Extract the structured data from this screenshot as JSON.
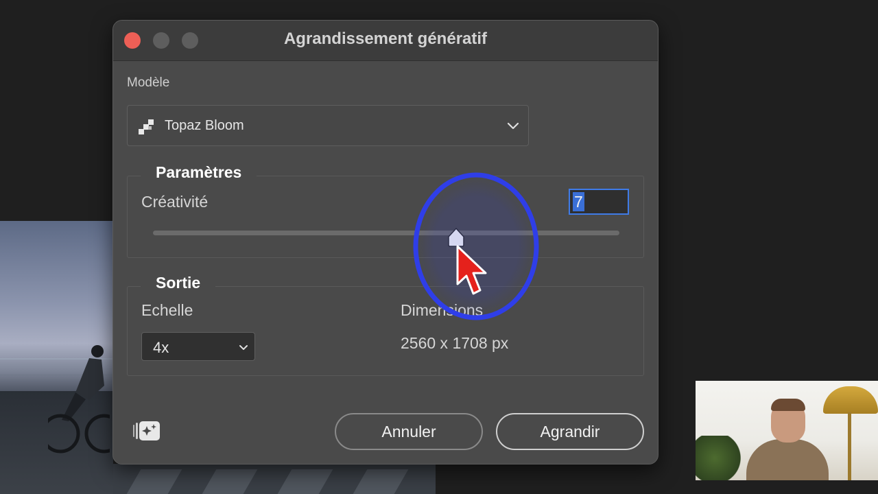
{
  "dialog": {
    "title": "Agrandissement génératif",
    "model_label": "Modèle",
    "model_value": "Topaz Bloom",
    "params_legend": "Paramètres",
    "creativity_label": "Créativité",
    "creativity_value": "7",
    "creativity_slider": {
      "value": 7,
      "min": 1,
      "max": 10
    },
    "output_legend": "Sortie",
    "scale_label": "Echelle",
    "scale_value": "4x",
    "dimensions_label": "Dimensions",
    "dimensions_value": "2560 x 1708 px",
    "cancel_label": "Annuler",
    "confirm_label": "Agrandir"
  },
  "icons": {
    "close": "close-dot-icon",
    "model": "pixel-staircase-icon",
    "dropdown": "chevron-down-icon",
    "generate": "sparkle-icon",
    "pointer": "cursor-arrow-icon"
  },
  "colors": {
    "accent": "#3f7be8",
    "close_button": "#ed5f56",
    "highlight_ring": "#2f3ee8",
    "cursor": "#e5211c"
  }
}
